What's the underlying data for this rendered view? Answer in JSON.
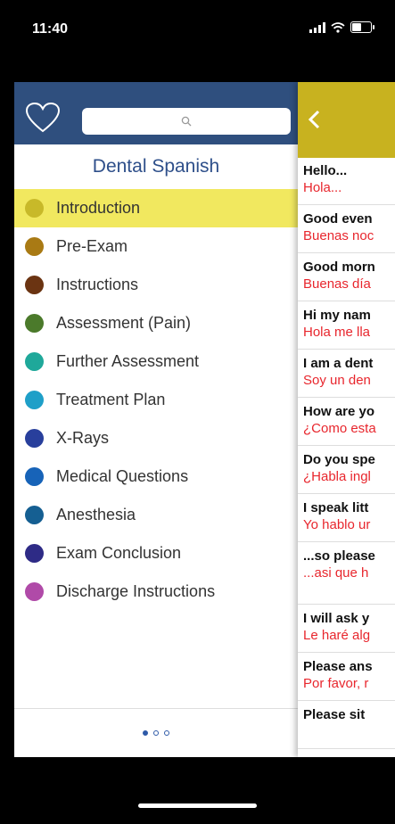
{
  "status": {
    "time": "11:40"
  },
  "search": {
    "placeholder": ""
  },
  "app_title": "Dental Spanish",
  "menu": [
    {
      "label": "Introduction",
      "color": "#c8b929",
      "active": true
    },
    {
      "label": "Pre-Exam",
      "color": "#a97a14",
      "active": false
    },
    {
      "label": "Instructions",
      "color": "#6b3412",
      "active": false
    },
    {
      "label": "Assessment (Pain)",
      "color": "#4b7a2b",
      "active": false
    },
    {
      "label": "Further Assessment",
      "color": "#1fa89a",
      "active": false
    },
    {
      "label": "Treatment Plan",
      "color": "#1e9fc8",
      "active": false
    },
    {
      "label": "X-Rays",
      "color": "#283f9c",
      "active": false
    },
    {
      "label": "Medical Questions",
      "color": "#1763b8",
      "active": false
    },
    {
      "label": "Anesthesia",
      "color": "#155f92",
      "active": false
    },
    {
      "label": "Exam Conclusion",
      "color": "#2e2b86",
      "active": false
    },
    {
      "label": "Discharge Instructions",
      "color": "#b04aa8",
      "active": false
    }
  ],
  "pager": {
    "total": 3,
    "current": 1
  },
  "phrases": [
    {
      "en": "Hello...",
      "es": "Hola..."
    },
    {
      "en": "Good even",
      "es": "Buenas noc"
    },
    {
      "en": "Good morn",
      "es": "Buenas día"
    },
    {
      "en": "Hi my nam",
      "es": "Hola me lla"
    },
    {
      "en": "I am a dent",
      "es": "Soy un den"
    },
    {
      "en": "How are yo",
      "es": "¿Como esta"
    },
    {
      "en": "Do you spe",
      "es": "¿Habla ingl"
    },
    {
      "en": "I speak litt",
      "es": "Yo hablo ur"
    },
    {
      "en": "...so please",
      "es": "...asi que h"
    },
    {
      "en": "I will ask y",
      "es": "Le haré alg"
    },
    {
      "en": "Please ans",
      "es": "Por favor, r"
    },
    {
      "en": "Please sit",
      "es": ""
    }
  ],
  "colors": {
    "left_header": "#2f4f7e",
    "right_header": "#c8b21f",
    "active_row": "#f1e85f",
    "spanish_text": "#e8262d"
  }
}
